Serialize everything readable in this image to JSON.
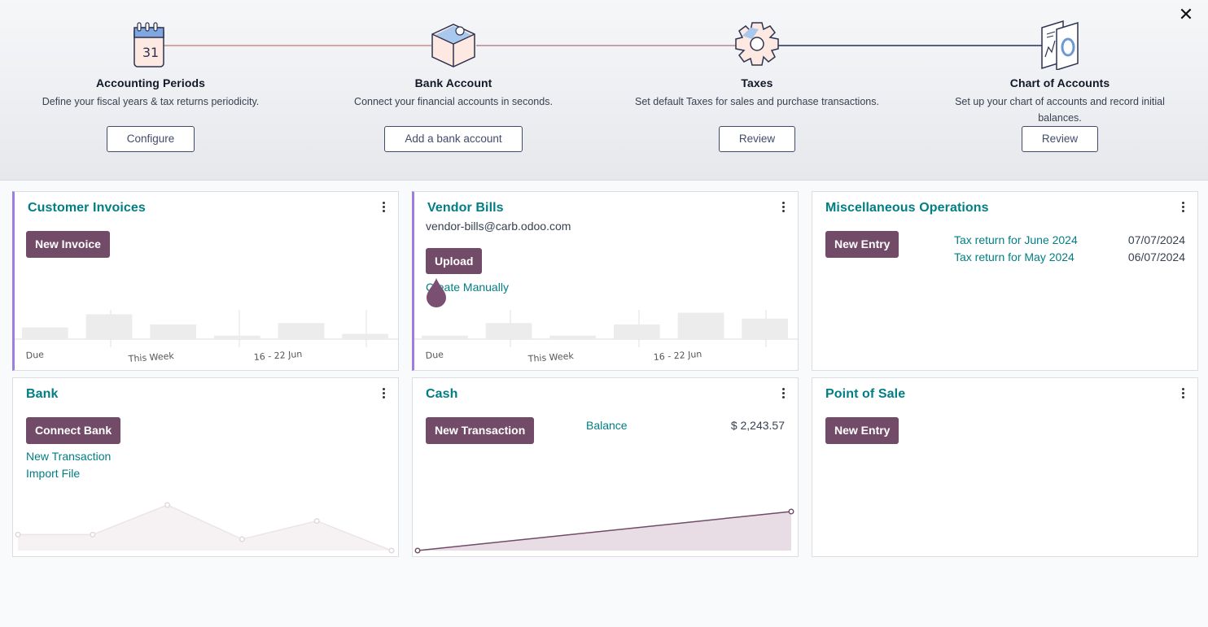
{
  "onboarding": {
    "steps": [
      {
        "title": "Accounting Periods",
        "description": "Define your fiscal years & tax returns periodicity.",
        "button": "Configure",
        "icon": "calendar-icon"
      },
      {
        "title": "Bank Account",
        "description": "Connect your financial accounts in seconds.",
        "button": "Add a bank account",
        "icon": "puzzle-piece-icon"
      },
      {
        "title": "Taxes",
        "description": "Set default Taxes for sales and purchase transactions.",
        "button": "Review",
        "icon": "gear-icon"
      },
      {
        "title": "Chart of Accounts",
        "description": "Set up your chart of accounts and record initial balances.",
        "button": "Review",
        "icon": "chart-documents-icon"
      }
    ],
    "close_label": "✕",
    "calendar_day": "31"
  },
  "cards": {
    "customer_invoices": {
      "title": "Customer Invoices",
      "button": "New Invoice",
      "bars": [
        0.4,
        0.85,
        0.5,
        0.12,
        0.55,
        0.18
      ],
      "labels": [
        "Due",
        "This Week",
        "16 - 22 Jun"
      ]
    },
    "vendor_bills": {
      "title": "Vendor Bills",
      "email": "vendor-bills@carb.odoo.com",
      "button": "Upload",
      "link": "Create Manually",
      "bars": [
        0.12,
        0.55,
        0.12,
        0.5,
        0.9,
        0.7
      ],
      "labels": [
        "Due",
        "This Week",
        "16 - 22 Jun"
      ]
    },
    "misc_operations": {
      "title": "Miscellaneous Operations",
      "button": "New Entry",
      "entries": [
        {
          "label": "Tax return for June 2024",
          "date": "07/07/2024"
        },
        {
          "label": "Tax return for May 2024",
          "date": "06/07/2024"
        }
      ]
    },
    "bank": {
      "title": "Bank",
      "button": "Connect Bank",
      "links": [
        "New Transaction",
        "Import File"
      ],
      "line_points": [
        0.35,
        0.35,
        1.0,
        0.25,
        0.65,
        0.0
      ]
    },
    "cash": {
      "title": "Cash",
      "button": "New Transaction",
      "balance_label": "Balance",
      "balance_value": "$ 2,243.57",
      "line_points": [
        0.0,
        1.0
      ]
    },
    "point_of_sale": {
      "title": "Point of Sale",
      "button": "New Entry"
    }
  },
  "colors": {
    "brand": "#714b67",
    "link": "#017e84",
    "accent_border": "#9b7fe0",
    "outline_button": "#434b6b"
  }
}
